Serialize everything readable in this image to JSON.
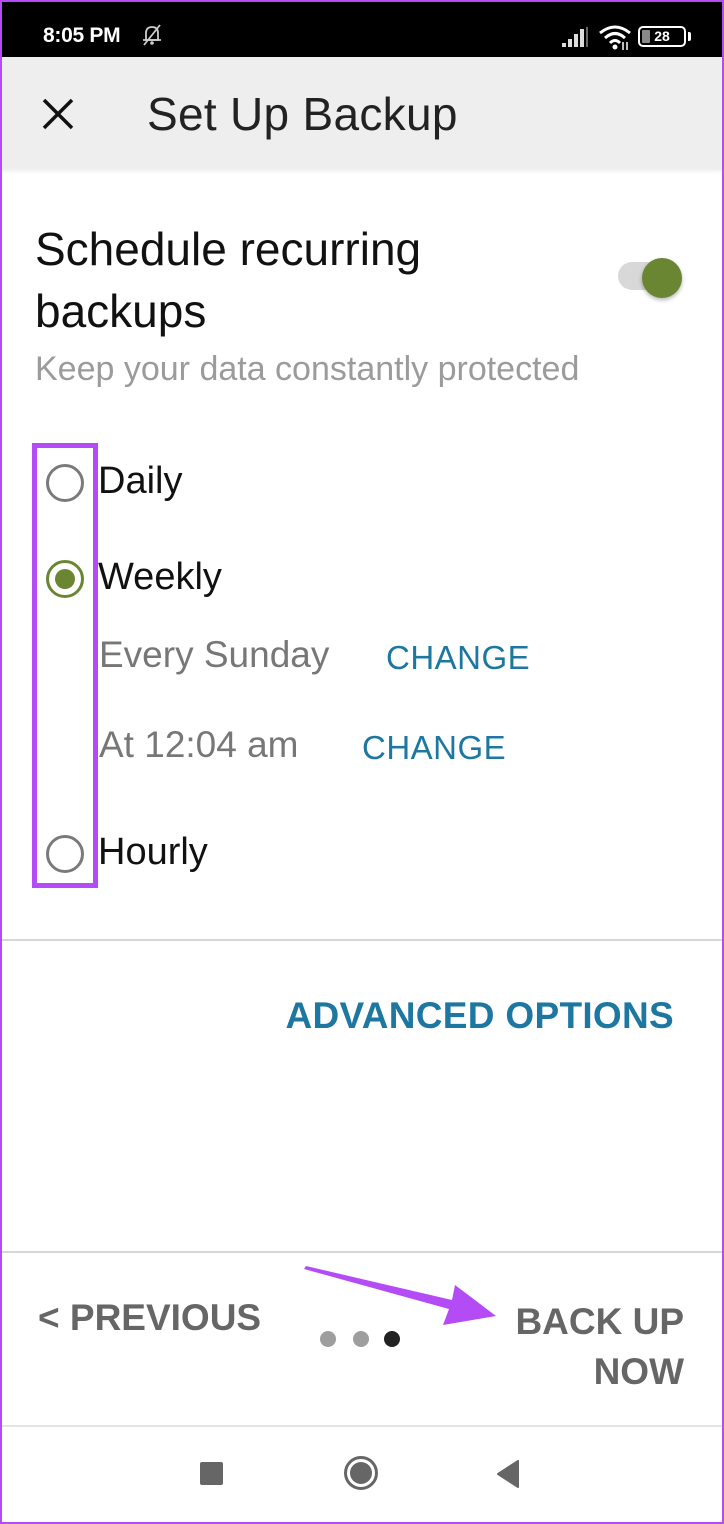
{
  "status_bar": {
    "time": "8:05 PM",
    "mute_icon": "bell-off-icon",
    "signal_icon": "signal-icon",
    "wifi_icon": "wifi-icon",
    "battery_level": "28"
  },
  "header": {
    "close_icon": "close-icon",
    "title": "Set Up Backup"
  },
  "schedule": {
    "title": "Schedule recurring backups",
    "subtitle": "Keep your data constantly protected",
    "toggle_on": true,
    "accent_color": "#6a8633"
  },
  "frequency_options": [
    {
      "label": "Daily",
      "selected": false
    },
    {
      "label": "Weekly",
      "selected": true
    },
    {
      "label": "Hourly",
      "selected": false
    }
  ],
  "weekly_details": {
    "day": "Every Sunday",
    "day_change_label": "CHANGE",
    "time": "At 12:04 am",
    "time_change_label": "CHANGE"
  },
  "advanced_options_label": "ADVANCED OPTIONS",
  "footer": {
    "previous_label": "< PREVIOUS",
    "next_label_line1": "BACK UP",
    "next_label_line2": "NOW",
    "page_count": 3,
    "current_page": 3
  },
  "nav_bar": {
    "recents_icon": "square-icon",
    "home_icon": "circle-icon",
    "back_icon": "triangle-back-icon"
  },
  "annotation_color": "#b44cf5",
  "link_color": "#1d77a0"
}
